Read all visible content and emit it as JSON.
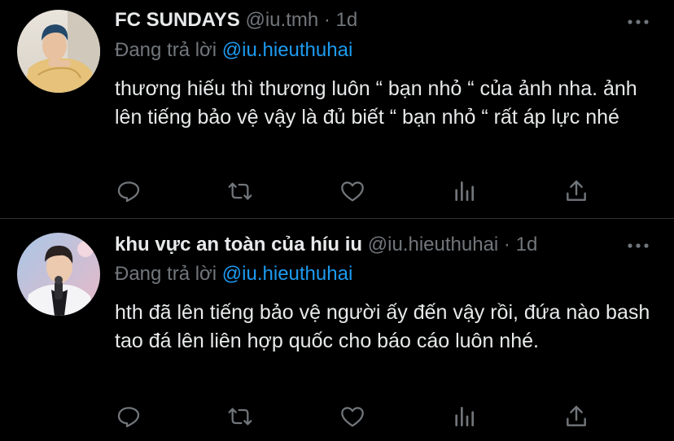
{
  "tweets": [
    {
      "display_name": "FC SUNDAYS",
      "handle": "@iu.tmh",
      "separator": "·",
      "time": "1d",
      "replying_to_label": "Đang trả lời",
      "replying_to_handle": "@iu.hieuthuhai",
      "text": "thương hiếu thì thương luôn “ bạn nhỏ “ của ảnh nha. ảnh lên tiếng bảo vệ vậy là đủ biết “ bạn nhỏ “ rất áp lực nhé",
      "avatar_icon": "profile-photo"
    },
    {
      "display_name": "khu vực an toàn của híu iu",
      "handle": "@iu.hieuthuhai",
      "separator": "·",
      "time": "1d",
      "replying_to_label": "Đang trả lời",
      "replying_to_handle": "@iu.hieuthuhai",
      "text": "hth đã lên tiếng bảo vệ người ấy đến vậy rồi, đứa nào bash tao đá lên liên hợp quốc cho báo cáo luôn nhé.",
      "avatar_icon": "profile-photo"
    }
  ],
  "action_icons": [
    "reply-icon",
    "retweet-icon",
    "like-icon",
    "analytics-icon",
    "share-icon"
  ],
  "colors": {
    "background": "#000000",
    "primary_text": "#e7e9ea",
    "secondary_text": "#71767b",
    "accent": "#1d9bf0",
    "divider": "#2f3336"
  }
}
